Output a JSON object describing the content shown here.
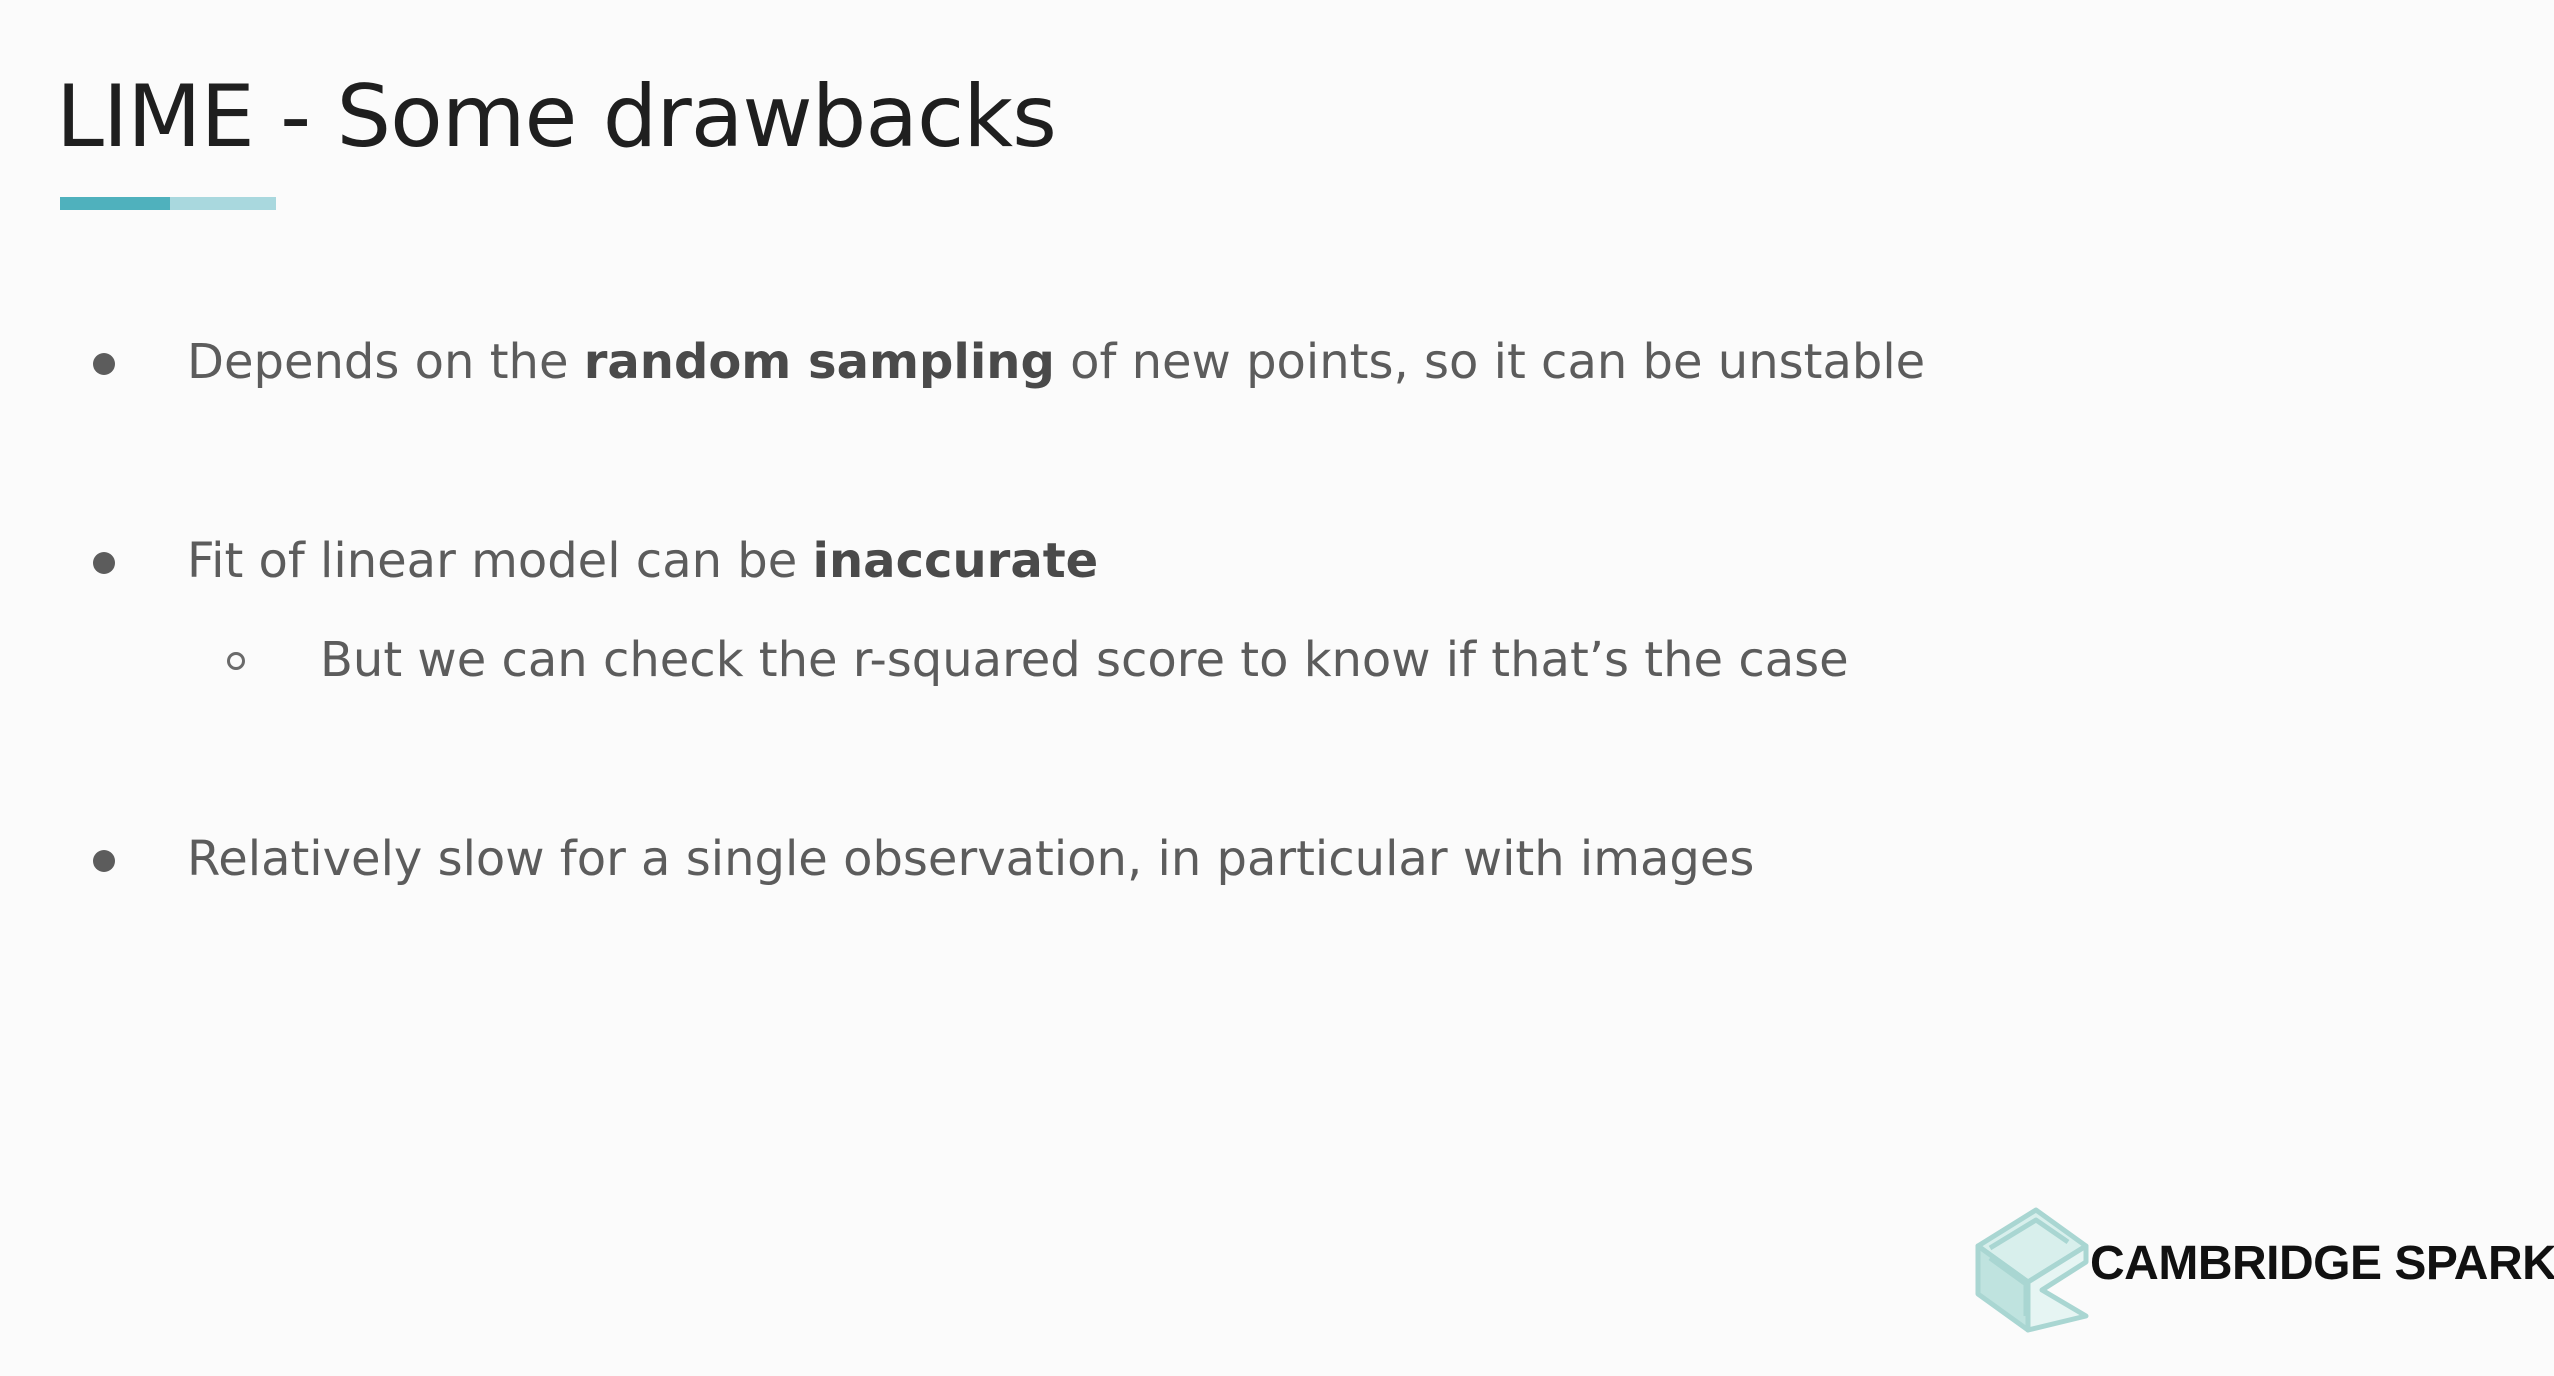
{
  "slide": {
    "title": "LIME - Some drawbacks",
    "accent_colors": {
      "primary": "#4fb1bd",
      "secondary": "#a9d8de"
    },
    "bullets": [
      {
        "level": 1,
        "segments": [
          {
            "text": "Depends on the ",
            "bold": false
          },
          {
            "text": "random sampling",
            "bold": true
          },
          {
            "text": " of new points, so it can be unstable",
            "bold": false
          }
        ]
      },
      {
        "level": 1,
        "segments": [
          {
            "text": "Fit of linear model can be ",
            "bold": false
          },
          {
            "text": "inaccurate",
            "bold": true
          }
        ]
      },
      {
        "level": 2,
        "segments": [
          {
            "text": "But we can check the r-squared score to know if that’s the case",
            "bold": false
          }
        ]
      },
      {
        "level": 1,
        "segments": [
          {
            "text": "Relatively slow for a single observation, in particular with images",
            "bold": false
          }
        ]
      }
    ],
    "logo": {
      "text": "CAMBRIDGE SPARK",
      "icon": "cambridge-spark-logo-icon",
      "color": "#a9d6d2"
    }
  }
}
